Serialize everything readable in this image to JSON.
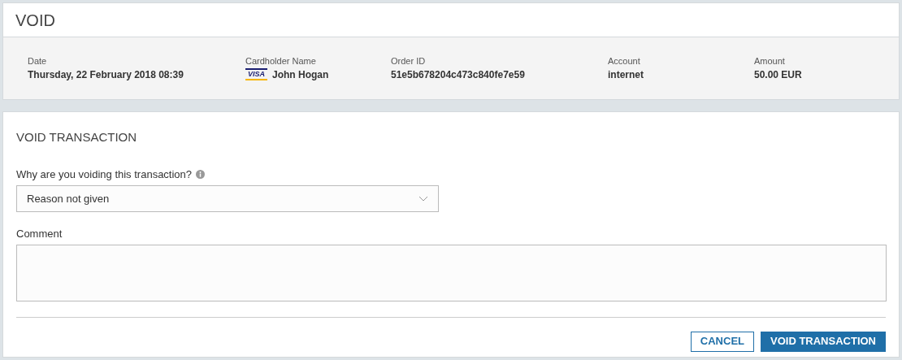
{
  "title": "VOID",
  "summary": [
    {
      "label": "Date",
      "value": "Thursday, 22 February 2018 08:39"
    },
    {
      "label": "Cardholder Name",
      "value": "John Hogan",
      "card_brand": "VISA"
    },
    {
      "label": "Order ID",
      "value": "51e5b678204c473c840fe7e59"
    },
    {
      "label": "Account",
      "value": "internet"
    },
    {
      "label": "Amount",
      "value": "50.00 EUR"
    }
  ],
  "form": {
    "title": "VOID TRANSACTION",
    "reason_label": "Why are you voiding this transaction?",
    "reason_value": "Reason not given",
    "comment_label": "Comment"
  },
  "buttons": [
    {
      "label": "CANCEL",
      "kind": "secondary"
    },
    {
      "label": "VOID TRANSACTION",
      "kind": "primary"
    }
  ]
}
